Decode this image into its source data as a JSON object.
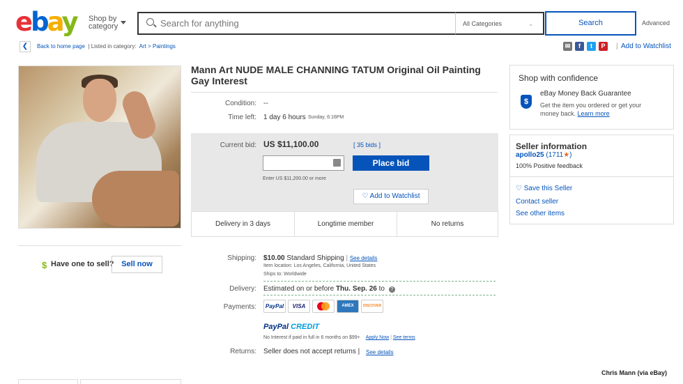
{
  "header": {
    "logo_letters": [
      "e",
      "b",
      "a",
      "y"
    ],
    "shop_by_line1": "Shop by",
    "shop_by_line2": "category",
    "search_placeholder": "Search for anything",
    "category_select": "All Categories",
    "search_button": "Search",
    "advanced_link": "Advanced"
  },
  "breadcrumb": {
    "back_to_home": "Back to home page",
    "listed_in": "| Listed in category:",
    "category_1": "Art",
    "separator": ">",
    "category_2": "Paintings"
  },
  "share_icons": [
    "mail-icon",
    "facebook-icon",
    "twitter-icon",
    "pinterest-icon"
  ],
  "add_to_watchlist_top": "Add to Watchlist",
  "left_panel": {
    "dollar_glyph": "$",
    "have_one": "Have one to sell?",
    "sell_now": "Sell now"
  },
  "item": {
    "title": "Mann Art NUDE MALE CHANNING TATUM Original Oil Painting Gay Interest",
    "condition_label": "Condition:",
    "condition_value": "--",
    "time_left_label": "Time left:",
    "time_left_value": "1 day 6 hours",
    "time_left_detail": "Sunday, 6:16PM",
    "current_bid_label": "Current bid:",
    "current_bid_value": "US $11,100.00",
    "bids_link": "[ 35 bids ]",
    "place_bid": "Place bid",
    "enter_hint": "Enter US $11,200.00 or more",
    "add_to_watchlist": "Add to Watchlist",
    "badges": [
      "Delivery in 3 days",
      "Longtime member",
      "No returns"
    ]
  },
  "shipping": {
    "shipping_label": "Shipping:",
    "shipping_cost": "$10.00",
    "shipping_method": "Standard Shipping",
    "see_details": "See details",
    "item_location": "Item location:  Los Angeles, California, United States",
    "ships_to": "Ships to:  Worldwide",
    "delivery_label": "Delivery:",
    "delivery_text": "Estimated on or before",
    "delivery_date": "Thu. Sep. 26",
    "delivery_to": "to",
    "payments_label": "Payments:",
    "payment_cards": [
      "PayPal",
      "VISA",
      "MC",
      "AMEX",
      "DISCOVER"
    ],
    "paypal_credit_1": "PayPal",
    "paypal_credit_2": "CREDIT",
    "credit_note": "No Interest if paid in full in 6 months on $99+",
    "apply_now": "Apply Now",
    "see_terms": "See terms",
    "returns_label": "Returns:",
    "returns_text": "Seller does not accept returns |",
    "returns_see_details": "See details"
  },
  "confidence": {
    "title": "Shop with confidence",
    "guarantee_title": "eBay Money Back Guarantee",
    "guarantee_text_1": "Get the item you ordered or get your",
    "guarantee_text_2": "money back.",
    "learn_more": "Learn more"
  },
  "seller": {
    "title": "Seller information",
    "name": "apollo25",
    "feedback_count": "(1711",
    "feedback_close": ")",
    "positive": "100% Positive feedback",
    "save_seller": "Save this Seller",
    "contact": "Contact seller",
    "other_items": "See other items"
  },
  "photo_credit": "Chris Mann (via eBay)",
  "colors": {
    "ebay_red": "#e53238",
    "ebay_blue": "#0064d2",
    "ebay_yellow": "#f5af02",
    "ebay_green": "#86b817",
    "link_blue": "#0654ba"
  }
}
